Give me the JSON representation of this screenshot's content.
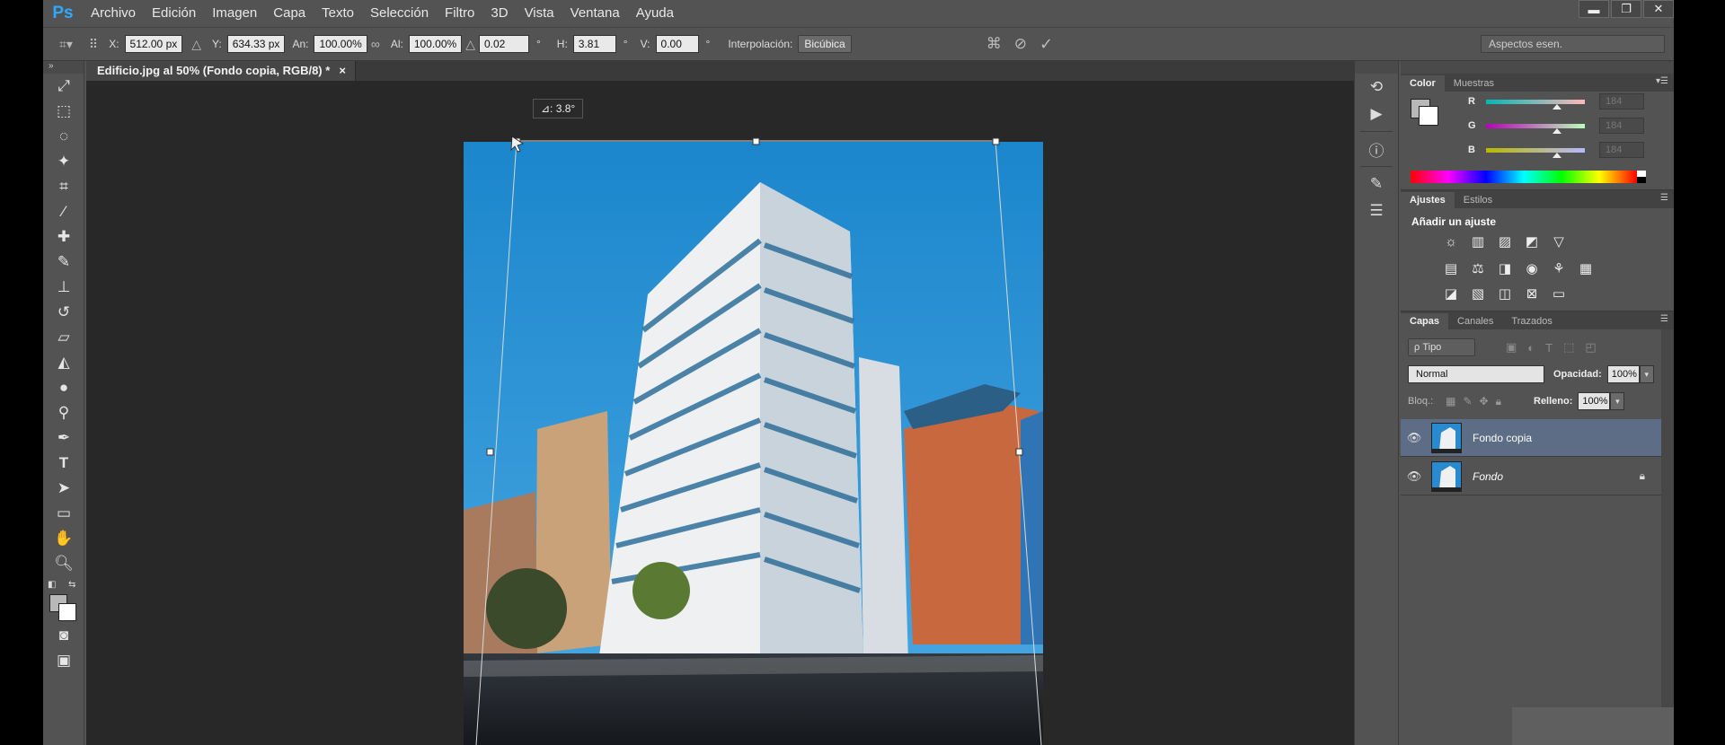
{
  "app": {
    "logo": "Ps"
  },
  "menu": [
    "Archivo",
    "Edición",
    "Imagen",
    "Capa",
    "Texto",
    "Selección",
    "Filtro",
    "3D",
    "Vista",
    "Ventana",
    "Ayuda"
  ],
  "window_controls": [
    "▬",
    "❐",
    "✕"
  ],
  "options": {
    "x_label": "X:",
    "x_value": "512.00 px",
    "y_label": "Y:",
    "y_value": "634.33 px",
    "w_label": "An:",
    "w_value": "100.00%",
    "h_label": "Al:",
    "h_value": "100.00%",
    "angle_value": "0.02",
    "deg": "°",
    "hskew_label": "H:",
    "hskew_value": "3.81",
    "vskew_label": "V:",
    "vskew_value": "0.00",
    "interp_label": "Interpolación:",
    "interp_value": "Bicúbica",
    "workspace": "Aspectos esen."
  },
  "document": {
    "tab_title": "Edificio.jpg al 50% (Fondo copia, RGB/8) *",
    "tab_close": "×",
    "angle_tooltip": "⊿: 3.8°"
  },
  "panels": {
    "color": {
      "tabs": [
        "Color",
        "Muestras"
      ],
      "r_label": "R",
      "g_label": "G",
      "b_label": "B",
      "r": "184",
      "g": "184",
      "b": "184"
    },
    "adjustments": {
      "tabs": [
        "Ajustes",
        "Estilos"
      ],
      "title": "Añadir un ajuste"
    },
    "layers": {
      "tabs": [
        "Capas",
        "Canales",
        "Trazados"
      ],
      "kind": "ρ Tipo",
      "blend_mode": "Normal",
      "opacity_label": "Opacidad:",
      "opacity": "100%",
      "lock_label": "Bloq.:",
      "fill_label": "Relleno:",
      "fill": "100%",
      "items": [
        {
          "name": "Fondo copia",
          "selected": true
        },
        {
          "name": "Fondo",
          "locked": true
        }
      ]
    }
  },
  "colors": {
    "ui": "#535353",
    "canvas": "#282828",
    "accent": "#31a8ff",
    "selected_layer": "#5d6d86"
  }
}
